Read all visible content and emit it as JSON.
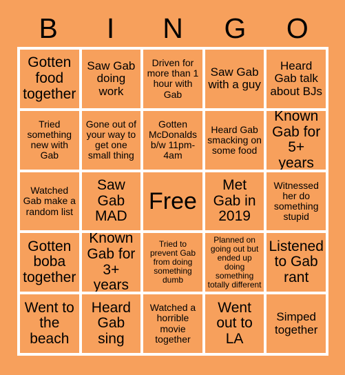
{
  "theme": {
    "background_color": "#f7a05c",
    "grid_line_color": "#ffffff",
    "text_color": "#000000"
  },
  "header": {
    "letters": [
      "B",
      "I",
      "N",
      "G",
      "O"
    ]
  },
  "grid": {
    "rows": 5,
    "columns": 5,
    "cells": [
      {
        "text": "Gotten food together",
        "size": "lg"
      },
      {
        "text": "Saw Gab doing work",
        "size": "md"
      },
      {
        "text": "Driven for more than 1 hour with Gab",
        "size": "sm"
      },
      {
        "text": "Saw Gab with a guy",
        "size": "md"
      },
      {
        "text": "Heard Gab talk about BJs",
        "size": "md"
      },
      {
        "text": "Tried something new with Gab",
        "size": "sm"
      },
      {
        "text": "Gone out of your way to get one small thing",
        "size": "sm"
      },
      {
        "text": "Gotten McDonalds b/w 11pm-4am",
        "size": "sm"
      },
      {
        "text": "Heard Gab smacking on some food",
        "size": "sm"
      },
      {
        "text": "Known Gab for 5+ years",
        "size": "lg"
      },
      {
        "text": "Watched Gab make a random list",
        "size": "sm"
      },
      {
        "text": "Saw Gab MAD",
        "size": "lg"
      },
      {
        "text": "Free",
        "size": "xl"
      },
      {
        "text": "Met Gab in 2019",
        "size": "lg"
      },
      {
        "text": "Witnessed her do something stupid",
        "size": "sm"
      },
      {
        "text": "Gotten boba together",
        "size": "lg"
      },
      {
        "text": "Known Gab for 3+ years",
        "size": "lg"
      },
      {
        "text": "Tried to prevent Gab from doing something dumb",
        "size": "xs"
      },
      {
        "text": "Planned on going out but ended up doing something totally different",
        "size": "xs"
      },
      {
        "text": "Listened to Gab rant",
        "size": "lg"
      },
      {
        "text": "Went to the beach",
        "size": "lg"
      },
      {
        "text": "Heard Gab sing",
        "size": "lg"
      },
      {
        "text": "Watched a horrible movie together",
        "size": "sm"
      },
      {
        "text": "Went out to LA",
        "size": "lg"
      },
      {
        "text": "Simped together",
        "size": "md"
      }
    ]
  }
}
